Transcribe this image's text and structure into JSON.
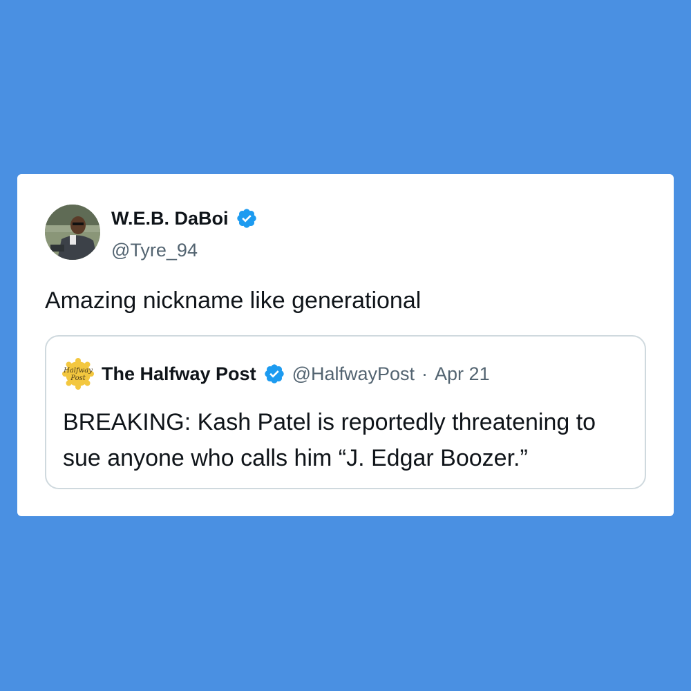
{
  "colors": {
    "background": "#4a90e2",
    "card": "#ffffff",
    "verified": "#1d9bf0",
    "text_primary": "#0f1419",
    "text_secondary": "#536471",
    "quote_border": "#cfd9de"
  },
  "tweet": {
    "author_name": "W.E.B. DaBoi",
    "author_handle": "@Tyre_94",
    "avatar_icon": "profile-photo",
    "verified_icon": "verified-badge-icon",
    "text": "Amazing nickname like generational"
  },
  "quoted_tweet": {
    "logo_text": "Halfway Post",
    "author_name": "The Halfway Post",
    "author_handle": "@HalfwayPost",
    "separator": "·",
    "date": "Apr 21",
    "verified_icon": "verified-badge-icon",
    "text": "BREAKING: Kash Patel is reportedly threatening to sue anyone who calls him “J. Edgar Boozer.”"
  }
}
